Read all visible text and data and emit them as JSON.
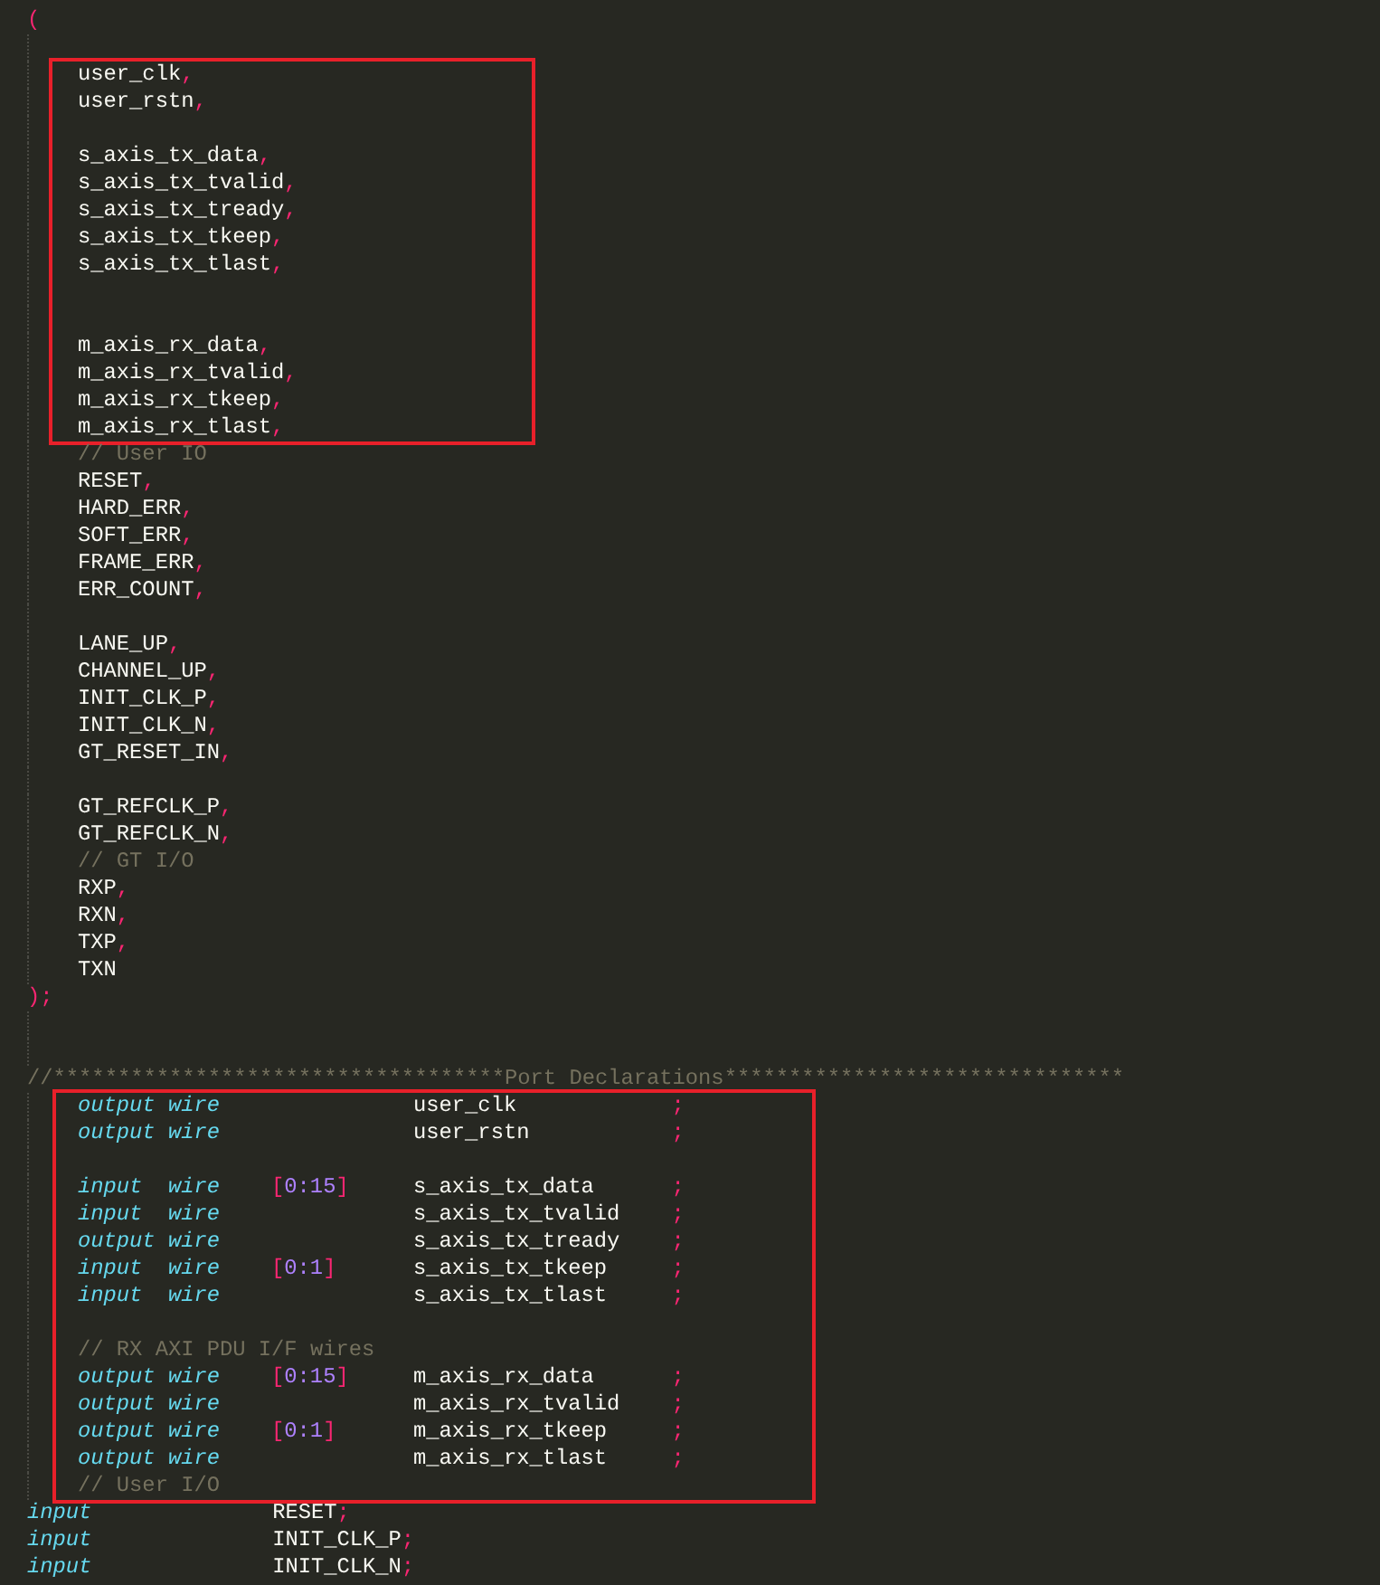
{
  "editor": {
    "blocks": [
      {
        "highlighted": false,
        "lines": [
          {
            "kind": "open",
            "text": "("
          },
          {
            "kind": "blank"
          }
        ]
      },
      {
        "highlighted": true,
        "lines": [
          {
            "kind": "port",
            "name": "user_clk",
            "sep": ","
          },
          {
            "kind": "port",
            "name": "user_rstn",
            "sep": ","
          },
          {
            "kind": "blank"
          },
          {
            "kind": "port",
            "name": "s_axis_tx_data",
            "sep": ","
          },
          {
            "kind": "port",
            "name": "s_axis_tx_tvalid",
            "sep": ","
          },
          {
            "kind": "port",
            "name": "s_axis_tx_tready",
            "sep": ","
          },
          {
            "kind": "port",
            "name": "s_axis_tx_tkeep",
            "sep": ","
          },
          {
            "kind": "port",
            "name": "s_axis_tx_tlast",
            "sep": ","
          },
          {
            "kind": "blank"
          },
          {
            "kind": "blank"
          },
          {
            "kind": "port",
            "name": "m_axis_rx_data",
            "sep": ","
          },
          {
            "kind": "port",
            "name": "m_axis_rx_tvalid",
            "sep": ","
          },
          {
            "kind": "port",
            "name": "m_axis_rx_tkeep",
            "sep": ","
          },
          {
            "kind": "port",
            "name": "m_axis_rx_tlast",
            "sep": ","
          }
        ]
      },
      {
        "highlighted": false,
        "lines": [
          {
            "kind": "comment",
            "text": "// User IO"
          },
          {
            "kind": "port",
            "name": "RESET",
            "sep": ","
          },
          {
            "kind": "port",
            "name": "HARD_ERR",
            "sep": ","
          },
          {
            "kind": "port",
            "name": "SOFT_ERR",
            "sep": ","
          },
          {
            "kind": "port",
            "name": "FRAME_ERR",
            "sep": ","
          },
          {
            "kind": "port",
            "name": "ERR_COUNT",
            "sep": ","
          },
          {
            "kind": "blank"
          },
          {
            "kind": "port",
            "name": "LANE_UP",
            "sep": ","
          },
          {
            "kind": "port",
            "name": "CHANNEL_UP",
            "sep": ","
          },
          {
            "kind": "port",
            "name": "INIT_CLK_P",
            "sep": ","
          },
          {
            "kind": "port",
            "name": "INIT_CLK_N",
            "sep": ","
          },
          {
            "kind": "port",
            "name": "GT_RESET_IN",
            "sep": ","
          },
          {
            "kind": "blank"
          },
          {
            "kind": "port",
            "name": "GT_REFCLK_P",
            "sep": ","
          },
          {
            "kind": "port",
            "name": "GT_REFCLK_N",
            "sep": ","
          },
          {
            "kind": "comment",
            "text": "// GT I/O"
          },
          {
            "kind": "port",
            "name": "RXP",
            "sep": ","
          },
          {
            "kind": "port",
            "name": "RXN",
            "sep": ","
          },
          {
            "kind": "port",
            "name": "TXP",
            "sep": ","
          },
          {
            "kind": "port",
            "name": "TXN"
          },
          {
            "kind": "close",
            "text": ");"
          },
          {
            "kind": "blank"
          },
          {
            "kind": "blank"
          },
          {
            "kind": "banner",
            "text": "//***********************************Port Declarations*******************************"
          }
        ]
      },
      {
        "highlighted": true,
        "lines": [
          {
            "kind": "decl",
            "direction": "output",
            "type": "wire",
            "name": "user_clk",
            "end": ";"
          },
          {
            "kind": "decl",
            "direction": "output",
            "type": "wire",
            "name": "user_rstn",
            "end": ";"
          },
          {
            "kind": "blank"
          },
          {
            "kind": "decl",
            "direction": "input",
            "type": "wire",
            "range": {
              "open": "[",
              "value": "0:15",
              "close": "]"
            },
            "name": "s_axis_tx_data",
            "end": ";"
          },
          {
            "kind": "decl",
            "direction": "input",
            "type": "wire",
            "name": "s_axis_tx_tvalid",
            "end": ";"
          },
          {
            "kind": "decl",
            "direction": "output",
            "type": "wire",
            "name": "s_axis_tx_tready",
            "end": ";"
          },
          {
            "kind": "decl",
            "direction": "input",
            "type": "wire",
            "range": {
              "open": "[",
              "value": "0:1",
              "close": "]"
            },
            "name": "s_axis_tx_tkeep",
            "end": ";"
          },
          {
            "kind": "decl",
            "direction": "input",
            "type": "wire",
            "name": "s_axis_tx_tlast",
            "end": ";"
          },
          {
            "kind": "blank"
          },
          {
            "kind": "comment",
            "text": "// RX AXI PDU I/F wires"
          },
          {
            "kind": "decl",
            "direction": "output",
            "type": "wire",
            "range": {
              "open": "[",
              "value": "0:15",
              "close": "]"
            },
            "name": "m_axis_rx_data",
            "end": ";"
          },
          {
            "kind": "decl",
            "direction": "output",
            "type": "wire",
            "name": "m_axis_rx_tvalid",
            "end": ";"
          },
          {
            "kind": "decl",
            "direction": "output",
            "type": "wire",
            "range": {
              "open": "[",
              "value": "0:1",
              "close": "]"
            },
            "name": "m_axis_rx_tkeep",
            "end": ";"
          },
          {
            "kind": "decl",
            "direction": "output",
            "type": "wire",
            "name": "m_axis_rx_tlast",
            "end": ";"
          },
          {
            "kind": "comment",
            "text": "// User I/O"
          }
        ]
      },
      {
        "highlighted": false,
        "lines": [
          {
            "kind": "flat",
            "direction": "input",
            "name": "RESET",
            "end": ";"
          },
          {
            "kind": "flat",
            "direction": "input",
            "name": "INIT_CLK_P",
            "end": ";"
          },
          {
            "kind": "flat",
            "direction": "input",
            "name": "INIT_CLK_N",
            "end": ";"
          }
        ]
      }
    ]
  }
}
